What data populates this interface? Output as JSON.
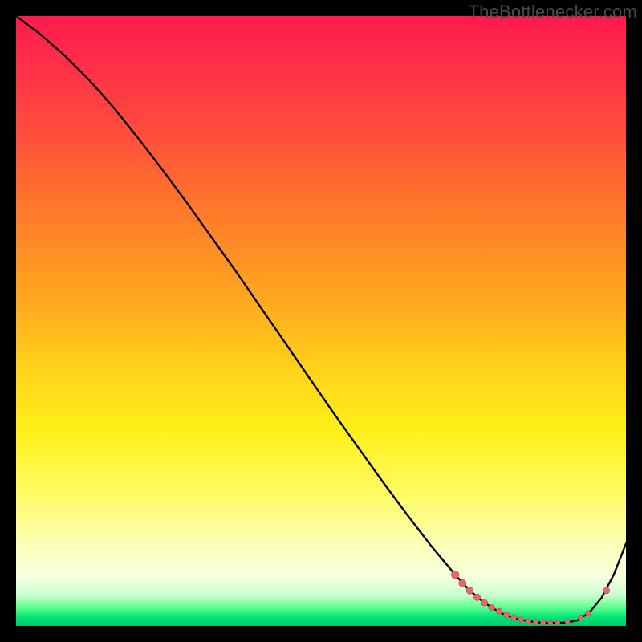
{
  "watermark": "TheBottlenecker.com",
  "colors": {
    "line": "#000000",
    "dot_fill": "#e46a6a",
    "dot_stroke": "#c44848"
  },
  "chart_data": {
    "type": "line",
    "title": "",
    "xlabel": "",
    "ylabel": "",
    "xlim": [
      0,
      100
    ],
    "ylim": [
      0,
      100
    ],
    "series": [
      {
        "name": "curve",
        "x": [
          0,
          4,
          8,
          12,
          16,
          20,
          24,
          28,
          32,
          36,
          40,
          44,
          48,
          52,
          56,
          60,
          64,
          68,
          72,
          74,
          76,
          78,
          80,
          82,
          84,
          86,
          88,
          90,
          92,
          94,
          96,
          98,
          100
        ],
        "y": [
          100,
          97,
          93.5,
          89.5,
          85,
          80,
          74.8,
          69.4,
          63.8,
          58.2,
          52.4,
          46.6,
          40.8,
          35,
          29.4,
          23.8,
          18.4,
          13.2,
          8.4,
          6.2,
          4.4,
          3,
          1.9,
          1.2,
          0.8,
          0.55,
          0.5,
          0.55,
          0.9,
          2.2,
          4.6,
          8.4,
          13.5
        ]
      }
    ],
    "dots": [
      {
        "x": 72.0,
        "y": 8.4,
        "r": 4.8
      },
      {
        "x": 73.2,
        "y": 7.0,
        "r": 4.6
      },
      {
        "x": 74.4,
        "y": 5.8,
        "r": 4.4
      },
      {
        "x": 75.6,
        "y": 4.7,
        "r": 4.2
      },
      {
        "x": 76.8,
        "y": 3.8,
        "r": 4.0
      },
      {
        "x": 78.0,
        "y": 3.0,
        "r": 3.8
      },
      {
        "x": 79.2,
        "y": 2.4,
        "r": 3.7
      },
      {
        "x": 80.4,
        "y": 1.8,
        "r": 3.6
      },
      {
        "x": 81.6,
        "y": 1.4,
        "r": 3.5
      },
      {
        "x": 82.8,
        "y": 1.05,
        "r": 3.4
      },
      {
        "x": 84.0,
        "y": 0.8,
        "r": 3.3
      },
      {
        "x": 85.2,
        "y": 0.65,
        "r": 3.2
      },
      {
        "x": 86.4,
        "y": 0.55,
        "r": 3.1
      },
      {
        "x": 87.6,
        "y": 0.5,
        "r": 3.0
      },
      {
        "x": 88.8,
        "y": 0.55,
        "r": 3.0
      },
      {
        "x": 90.4,
        "y": 0.7,
        "r": 3.0
      },
      {
        "x": 92.6,
        "y": 1.4,
        "r": 3.1
      },
      {
        "x": 93.8,
        "y": 2.1,
        "r": 3.3
      },
      {
        "x": 96.8,
        "y": 5.8,
        "r": 4.0
      }
    ]
  }
}
